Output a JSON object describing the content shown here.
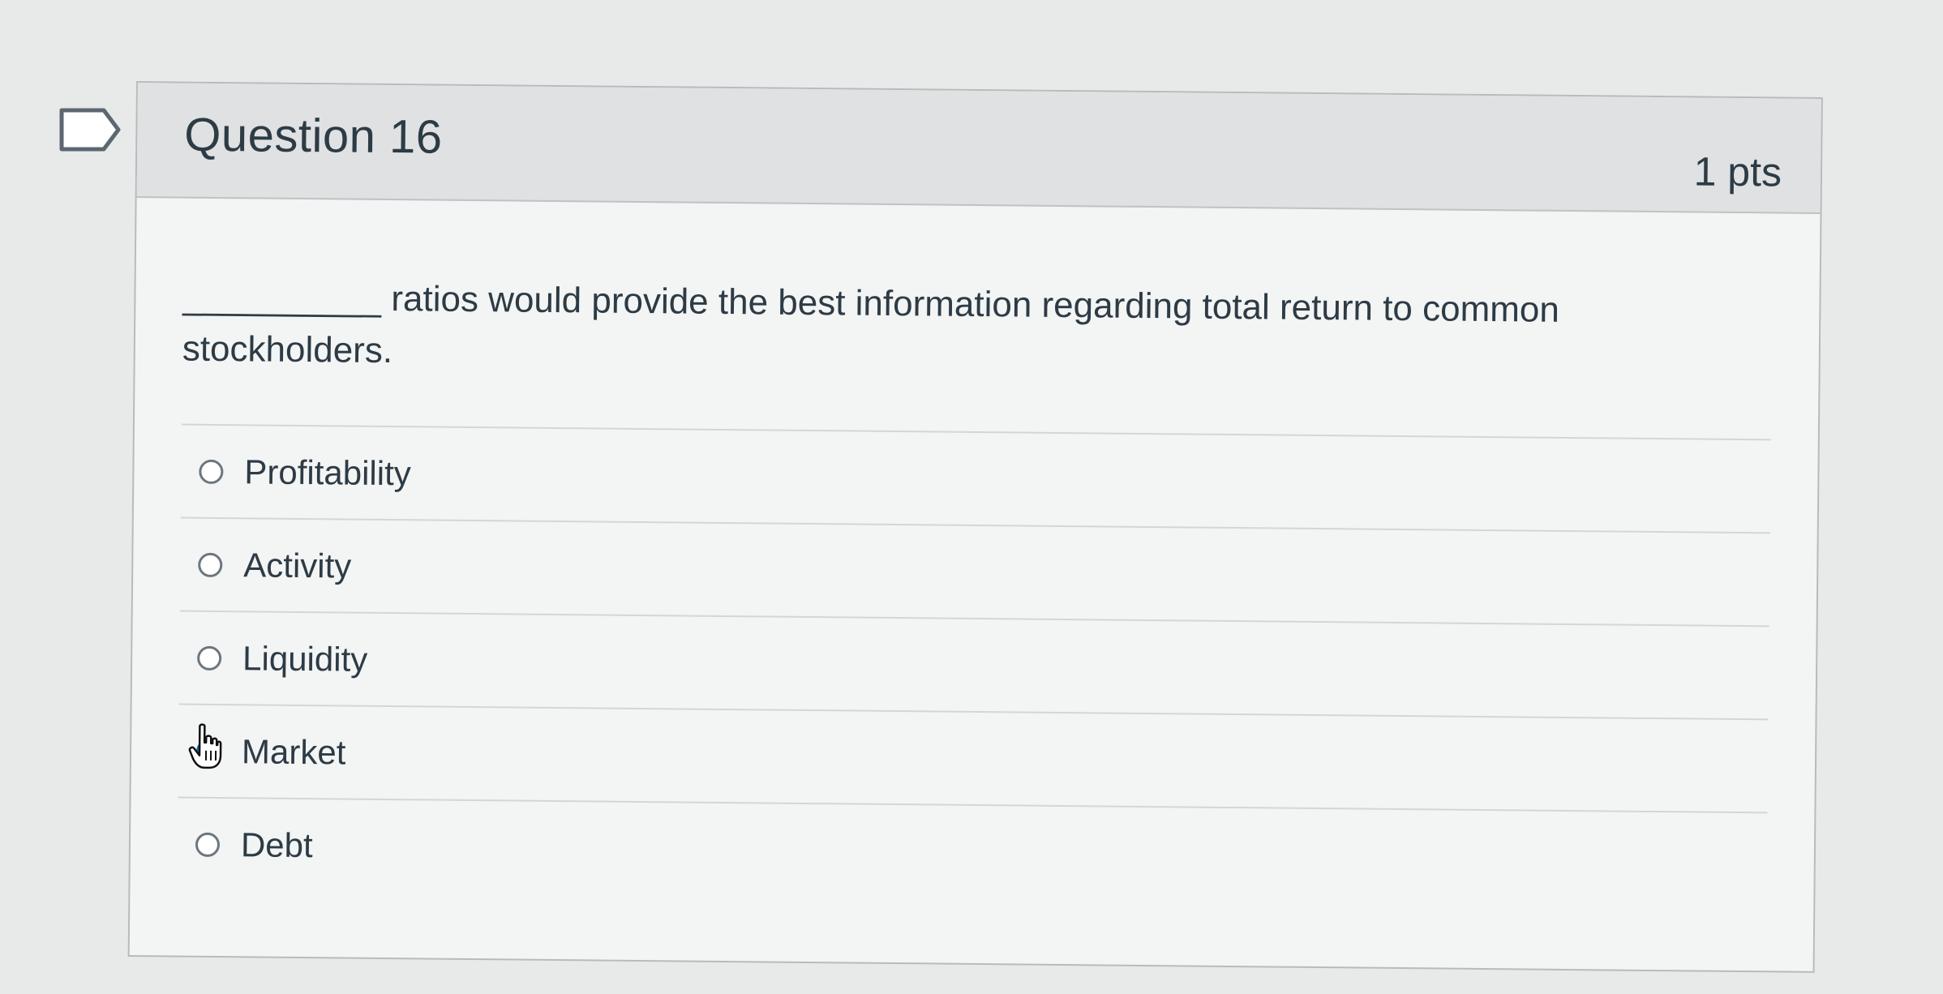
{
  "question": {
    "title": "Question 16",
    "points": "1 pts",
    "text": "__________ ratios would provide the best information regarding total return to common stockholders.",
    "answers": [
      {
        "label": "Profitability",
        "selected": false
      },
      {
        "label": "Activity",
        "selected": false
      },
      {
        "label": "Liquidity",
        "selected": false
      },
      {
        "label": "Market",
        "selected": true
      },
      {
        "label": "Debt",
        "selected": false
      }
    ]
  },
  "icons": {
    "bookmark": "bookmark-flag-icon",
    "cursor": "hand-pointer-cursor-icon"
  },
  "colors": {
    "accent": "#0770a3",
    "text": "#2d3b45",
    "header_bg": "#dfe1e2"
  }
}
